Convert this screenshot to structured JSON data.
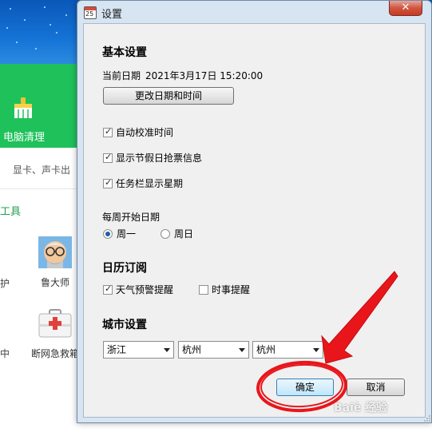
{
  "background_app": {
    "pc_clean_label": "电脑清理",
    "hardware_text": "显卡、声卡出",
    "tools_heading": "工具",
    "fix_text": "护",
    "ludashi_label": "鲁大师",
    "center_text": "中",
    "rescue_label": "断网急救箱"
  },
  "dialog": {
    "title": "设置",
    "title_icon_number": "25",
    "close_glyph": "✕",
    "basic": {
      "heading": "基本设置",
      "current_date_label": "当前日期",
      "current_date_value": "2021年3月17日 15:20:00",
      "change_button": "更改日期和时间",
      "checkboxes": [
        {
          "label": "自动校准时间",
          "checked": true
        },
        {
          "label": "显示节假日抢票信息",
          "checked": true
        },
        {
          "label": "任务栏显示星期",
          "checked": true
        }
      ],
      "week_start_label": "每周开始日期",
      "week_options": [
        {
          "label": "周一",
          "selected": true
        },
        {
          "label": "周日",
          "selected": false
        }
      ]
    },
    "subscribe": {
      "heading": "日历订阅",
      "options": [
        {
          "label": "天气预警提醒",
          "checked": true
        },
        {
          "label": "时事提醒",
          "checked": false
        }
      ]
    },
    "city": {
      "heading": "城市设置",
      "province": "浙江",
      "city": "杭州",
      "district": "杭州"
    },
    "ok_button": "确定",
    "cancel_button": "取消"
  },
  "annotation": {
    "color": "#e8161b",
    "watermark": "Baiè 经验"
  }
}
